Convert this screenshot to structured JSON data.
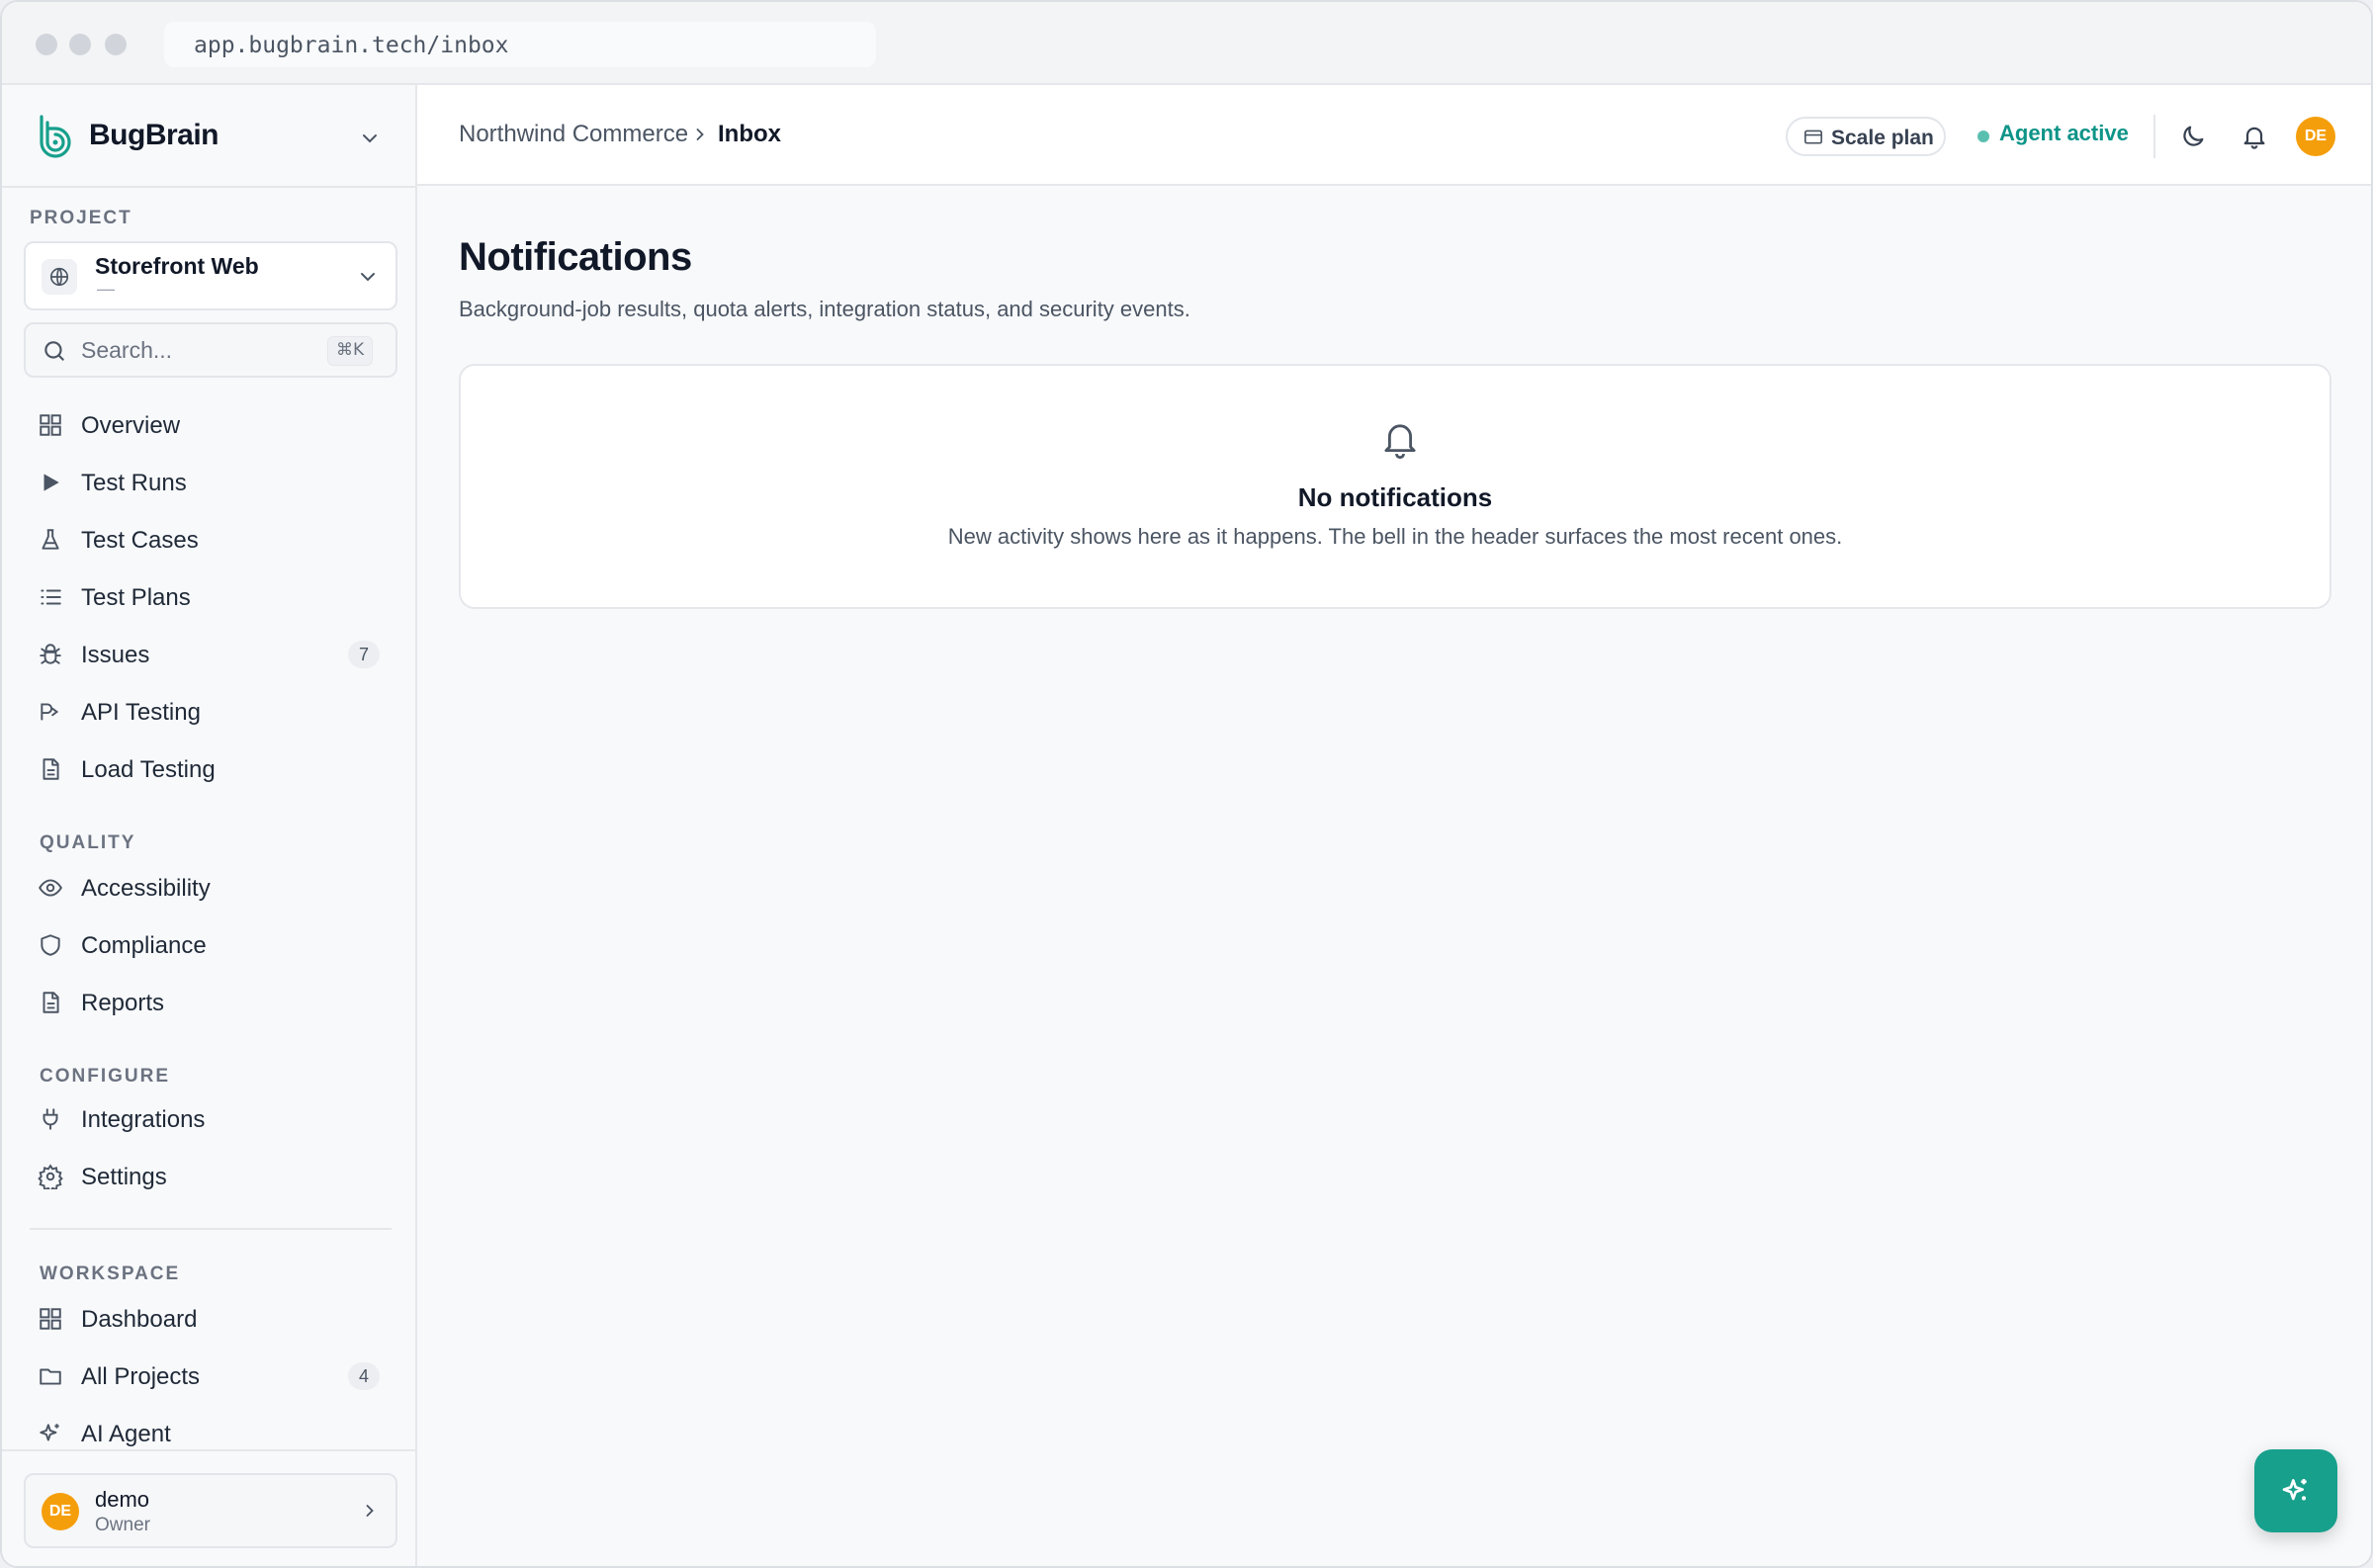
{
  "browser": {
    "url": "app.bugbrain.tech/inbox"
  },
  "brand": {
    "name": "BugBrain"
  },
  "project": {
    "section_label": "PROJECT",
    "name": "Storefront Web",
    "sub": "—"
  },
  "search": {
    "placeholder": "Search...",
    "shortcut": "⌘K"
  },
  "nav": {
    "main": [
      {
        "label": "Overview",
        "icon": "grid-icon"
      },
      {
        "label": "Test Runs",
        "icon": "play-icon"
      },
      {
        "label": "Test Cases",
        "icon": "flask-icon"
      },
      {
        "label": "Test Plans",
        "icon": "list-icon"
      },
      {
        "label": "Issues",
        "icon": "bug-icon",
        "badge": "7"
      },
      {
        "label": "API Testing",
        "icon": "api-icon"
      },
      {
        "label": "Load Testing",
        "icon": "file-icon"
      }
    ],
    "quality_label": "QUALITY",
    "quality": [
      {
        "label": "Accessibility",
        "icon": "eye-icon"
      },
      {
        "label": "Compliance",
        "icon": "shield-icon"
      },
      {
        "label": "Reports",
        "icon": "report-icon"
      }
    ],
    "configure_label": "CONFIGURE",
    "configure": [
      {
        "label": "Integrations",
        "icon": "plug-icon"
      },
      {
        "label": "Settings",
        "icon": "gear-icon"
      }
    ],
    "workspace_label": "WORKSPACE",
    "workspace": [
      {
        "label": "Dashboard",
        "icon": "grid-icon"
      },
      {
        "label": "All Projects",
        "icon": "folder-icon",
        "badge": "4"
      },
      {
        "label": "AI Agent",
        "icon": "sparkle-icon"
      }
    ]
  },
  "user": {
    "initials": "DE",
    "name": "demo",
    "role": "Owner"
  },
  "header": {
    "breadcrumb": [
      "Northwind Commerce",
      "Inbox"
    ],
    "plan_label": "Scale plan",
    "agent_status": "Agent active",
    "avatar_initials": "DE"
  },
  "page": {
    "title": "Notifications",
    "subtitle": "Background-job results, quota alerts, integration status, and security events.",
    "empty_title": "No notifications",
    "empty_message": "New activity shows here as it happens. The bell in the header surfaces the most recent ones."
  },
  "colors": {
    "accent": "#0d9488",
    "fab": "#17a08c",
    "avatar": "#f59e0b"
  }
}
